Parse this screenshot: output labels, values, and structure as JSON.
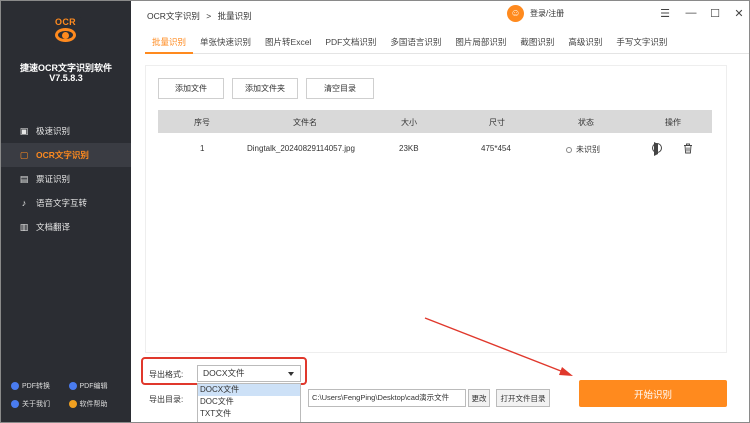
{
  "sidebar": {
    "logo_text": "OCR",
    "app_name": "捷速OCR文字识别软件",
    "version": "V7.5.8.3",
    "items": [
      {
        "label": "极速识别",
        "icon": "scan-icon",
        "active": false
      },
      {
        "label": "OCR文字识别",
        "icon": "ocr-icon",
        "active": true
      },
      {
        "label": "票证识别",
        "icon": "ticket-icon",
        "active": false
      },
      {
        "label": "语音文字互转",
        "icon": "microphone-icon",
        "active": false
      },
      {
        "label": "文档翻译",
        "icon": "translate-icon",
        "active": false
      }
    ],
    "bottom_links": [
      {
        "label": "PDF转换",
        "color": "#4a7cf0"
      },
      {
        "label": "PDF编辑",
        "color": "#4a7cf0"
      },
      {
        "label": "关于我们",
        "color": "#4a7cf0"
      },
      {
        "label": "软件帮助",
        "color": "#f0a020"
      }
    ]
  },
  "titlebar": {
    "crumb_root": "OCR文字识别",
    "crumb_sep": ">",
    "crumb_current": "批量识别",
    "login_label": "登录/注册"
  },
  "tabs": [
    {
      "label": "批量识别",
      "active": true
    },
    {
      "label": "单张快速识别"
    },
    {
      "label": "图片转Excel"
    },
    {
      "label": "PDF文档识别"
    },
    {
      "label": "多国语言识别"
    },
    {
      "label": "图片局部识别"
    },
    {
      "label": "截图识别"
    },
    {
      "label": "高级识别"
    },
    {
      "label": "手写文字识别"
    }
  ],
  "toolbar": {
    "add_file": "添加文件",
    "add_folder": "添加文件夹",
    "clear_list": "清空目录"
  },
  "table": {
    "headers": [
      "序号",
      "文件名",
      "大小",
      "尺寸",
      "状态",
      "操作"
    ],
    "rows": [
      {
        "index": "1",
        "filename": "Dingtalk_20240829114057.jpg",
        "size": "23KB",
        "dimensions": "475*454",
        "status": "未识别"
      }
    ]
  },
  "output": {
    "format_label": "导出格式:",
    "format_value": "DOCX文件",
    "format_options": [
      "DOCX文件",
      "DOC文件",
      "TXT文件"
    ],
    "dir_label": "导出目录:",
    "dir_value": "C:\\Users\\FengPing\\Desktop\\cad演示文件",
    "change_label": "更改",
    "open_dir_label": "打开文件目录",
    "start_label": "开始识别"
  },
  "colors": {
    "accent": "#ff8a1e",
    "sidebar_bg": "#2b2d33",
    "highlight": "#e0382c"
  }
}
